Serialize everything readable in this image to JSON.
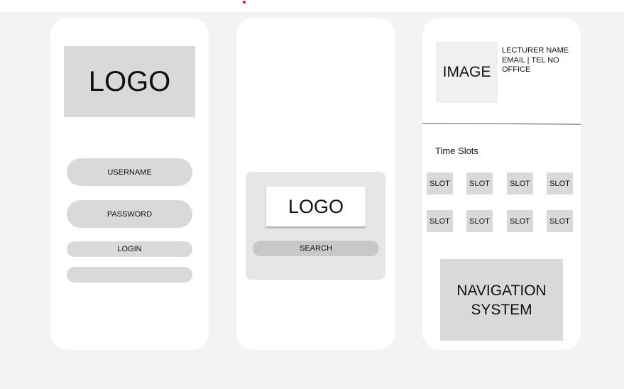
{
  "login_screen": {
    "logo": "LOGO",
    "username": "USERNAME",
    "password": "PASSWORD",
    "login": "LOGIN",
    "extra": ""
  },
  "search_screen": {
    "logo": "LOGO",
    "search": "SEARCH"
  },
  "lecturer_screen": {
    "image": "IMAGE",
    "name": "LECTURER NAME",
    "contact": "EMAIL | TEL NO",
    "office": "OFFICE",
    "time_slots_title": "Time Slots",
    "slots": [
      "SLOT",
      "SLOT",
      "SLOT",
      "SLOT",
      "SLOT",
      "SLOT",
      "SLOT",
      "SLOT"
    ],
    "navigation": "NAVIGATION SYSTEM"
  }
}
